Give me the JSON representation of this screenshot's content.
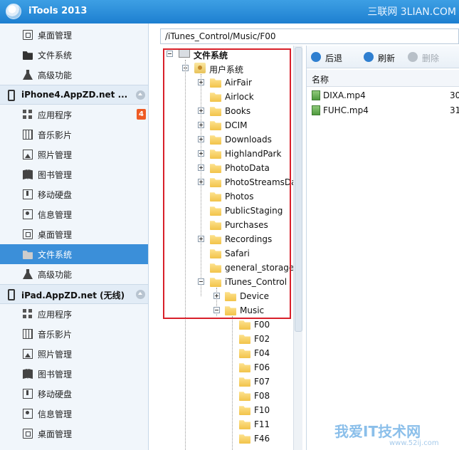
{
  "app": {
    "title": "iTools 2013",
    "watermark": "三联网 3LIAN.COM"
  },
  "sidebar": {
    "top_items": [
      {
        "label": "桌面管理",
        "icon": "desktop-icon"
      },
      {
        "label": "文件系统",
        "icon": "folder-icon"
      },
      {
        "label": "高级功能",
        "icon": "flask-icon"
      }
    ],
    "device1": {
      "name": "iPhone4.AppZD.net ...",
      "items": [
        {
          "label": "应用程序",
          "icon": "apps-grid-icon",
          "badge": "4"
        },
        {
          "label": "音乐影片",
          "icon": "film-icon"
        },
        {
          "label": "照片管理",
          "icon": "photo-icon"
        },
        {
          "label": "图书管理",
          "icon": "book-icon"
        },
        {
          "label": "移动硬盘",
          "icon": "drive-icon"
        },
        {
          "label": "信息管理",
          "icon": "contact-icon"
        },
        {
          "label": "桌面管理",
          "icon": "desktop-icon"
        },
        {
          "label": "文件系统",
          "icon": "folder-icon",
          "active": true
        },
        {
          "label": "高级功能",
          "icon": "flask-icon"
        }
      ]
    },
    "device2": {
      "name": "iPad.AppZD.net (无线)",
      "items": [
        {
          "label": "应用程序",
          "icon": "apps-grid-icon"
        },
        {
          "label": "音乐影片",
          "icon": "film-icon"
        },
        {
          "label": "照片管理",
          "icon": "photo-icon"
        },
        {
          "label": "图书管理",
          "icon": "book-icon"
        },
        {
          "label": "移动硬盘",
          "icon": "drive-icon"
        },
        {
          "label": "信息管理",
          "icon": "contact-icon"
        },
        {
          "label": "桌面管理",
          "icon": "desktop-icon"
        }
      ]
    }
  },
  "path": "/iTunes_Control/Music/F00",
  "tree": {
    "root": "文件系统",
    "user": "用户系统",
    "folders": [
      "AirFair",
      "Airlock",
      "Books",
      "DCIM",
      "Downloads",
      "HighlandPark",
      "PhotoData",
      "PhotoStreamsDa",
      "Photos",
      "PublicStaging",
      "Purchases",
      "Recordings",
      "Safari",
      "general_storage",
      "iTunes_Control"
    ],
    "itunes_children": [
      "Device",
      "Music"
    ],
    "music_children": [
      "F00",
      "F02",
      "F04",
      "F06",
      "F07",
      "F08",
      "F10",
      "F11",
      "F46"
    ]
  },
  "toolbar": {
    "back": "后退",
    "refresh": "刷新",
    "delete": "删除"
  },
  "files": {
    "header": "名称",
    "rows": [
      {
        "name": "DIXA.mp4",
        "size": "30"
      },
      {
        "name": "FUHC.mp4",
        "size": "31"
      }
    ]
  },
  "bottom_watermark": {
    "main": "我爱IT技术网",
    "sub": "www.52ij.com"
  }
}
